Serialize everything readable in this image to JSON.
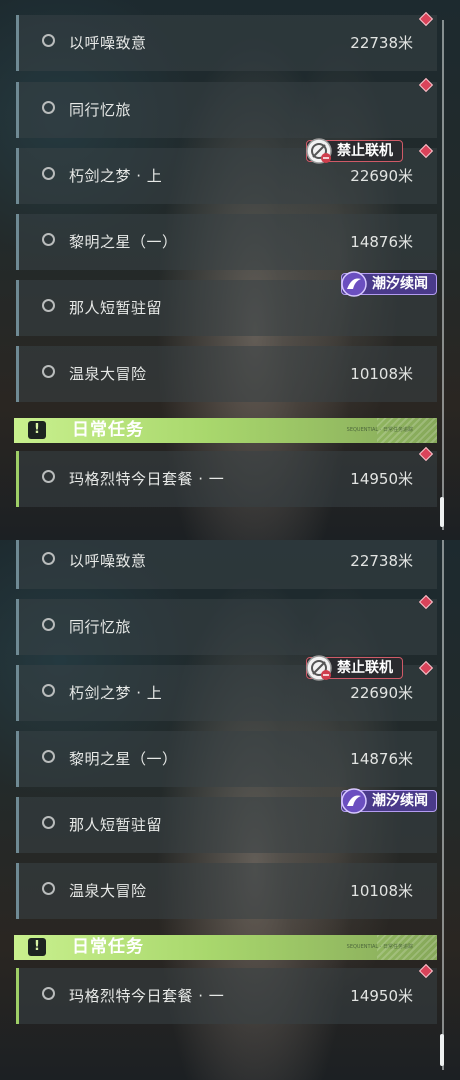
{
  "quests": [
    {
      "name": "以呼噪致意",
      "distance": "22738米"
    },
    {
      "name": "同行忆旅",
      "distance": ""
    },
    {
      "name": "朽剑之梦 · 上",
      "distance": "22690米"
    },
    {
      "name": "黎明之星（一）",
      "distance": "14876米"
    },
    {
      "name": "那人短暂驻留",
      "distance": ""
    },
    {
      "name": "温泉大冒险",
      "distance": "10108米"
    }
  ],
  "tags": {
    "no_multiplayer": "禁止联机",
    "tidal": "潮汐续闻"
  },
  "daily_section": {
    "icon": "!",
    "title": "日常任务",
    "small_text": "SEQUENTIAL · 日常任务追踪",
    "quests": [
      {
        "name": "玛格烈特今日套餐 · 一",
        "distance": "14950米"
      }
    ]
  },
  "colors": {
    "section_accent": "#b9e27a",
    "row_border": "#6f8a94",
    "marker": "#d9435a",
    "tag_no_multiplayer": "#cf5a67",
    "tag_tidal": "#6b4fc0"
  },
  "icons": [
    "quest-marker-icon",
    "no-multiplayer-icon",
    "tidal-icon",
    "exclamation-icon",
    "radio-icon"
  ]
}
